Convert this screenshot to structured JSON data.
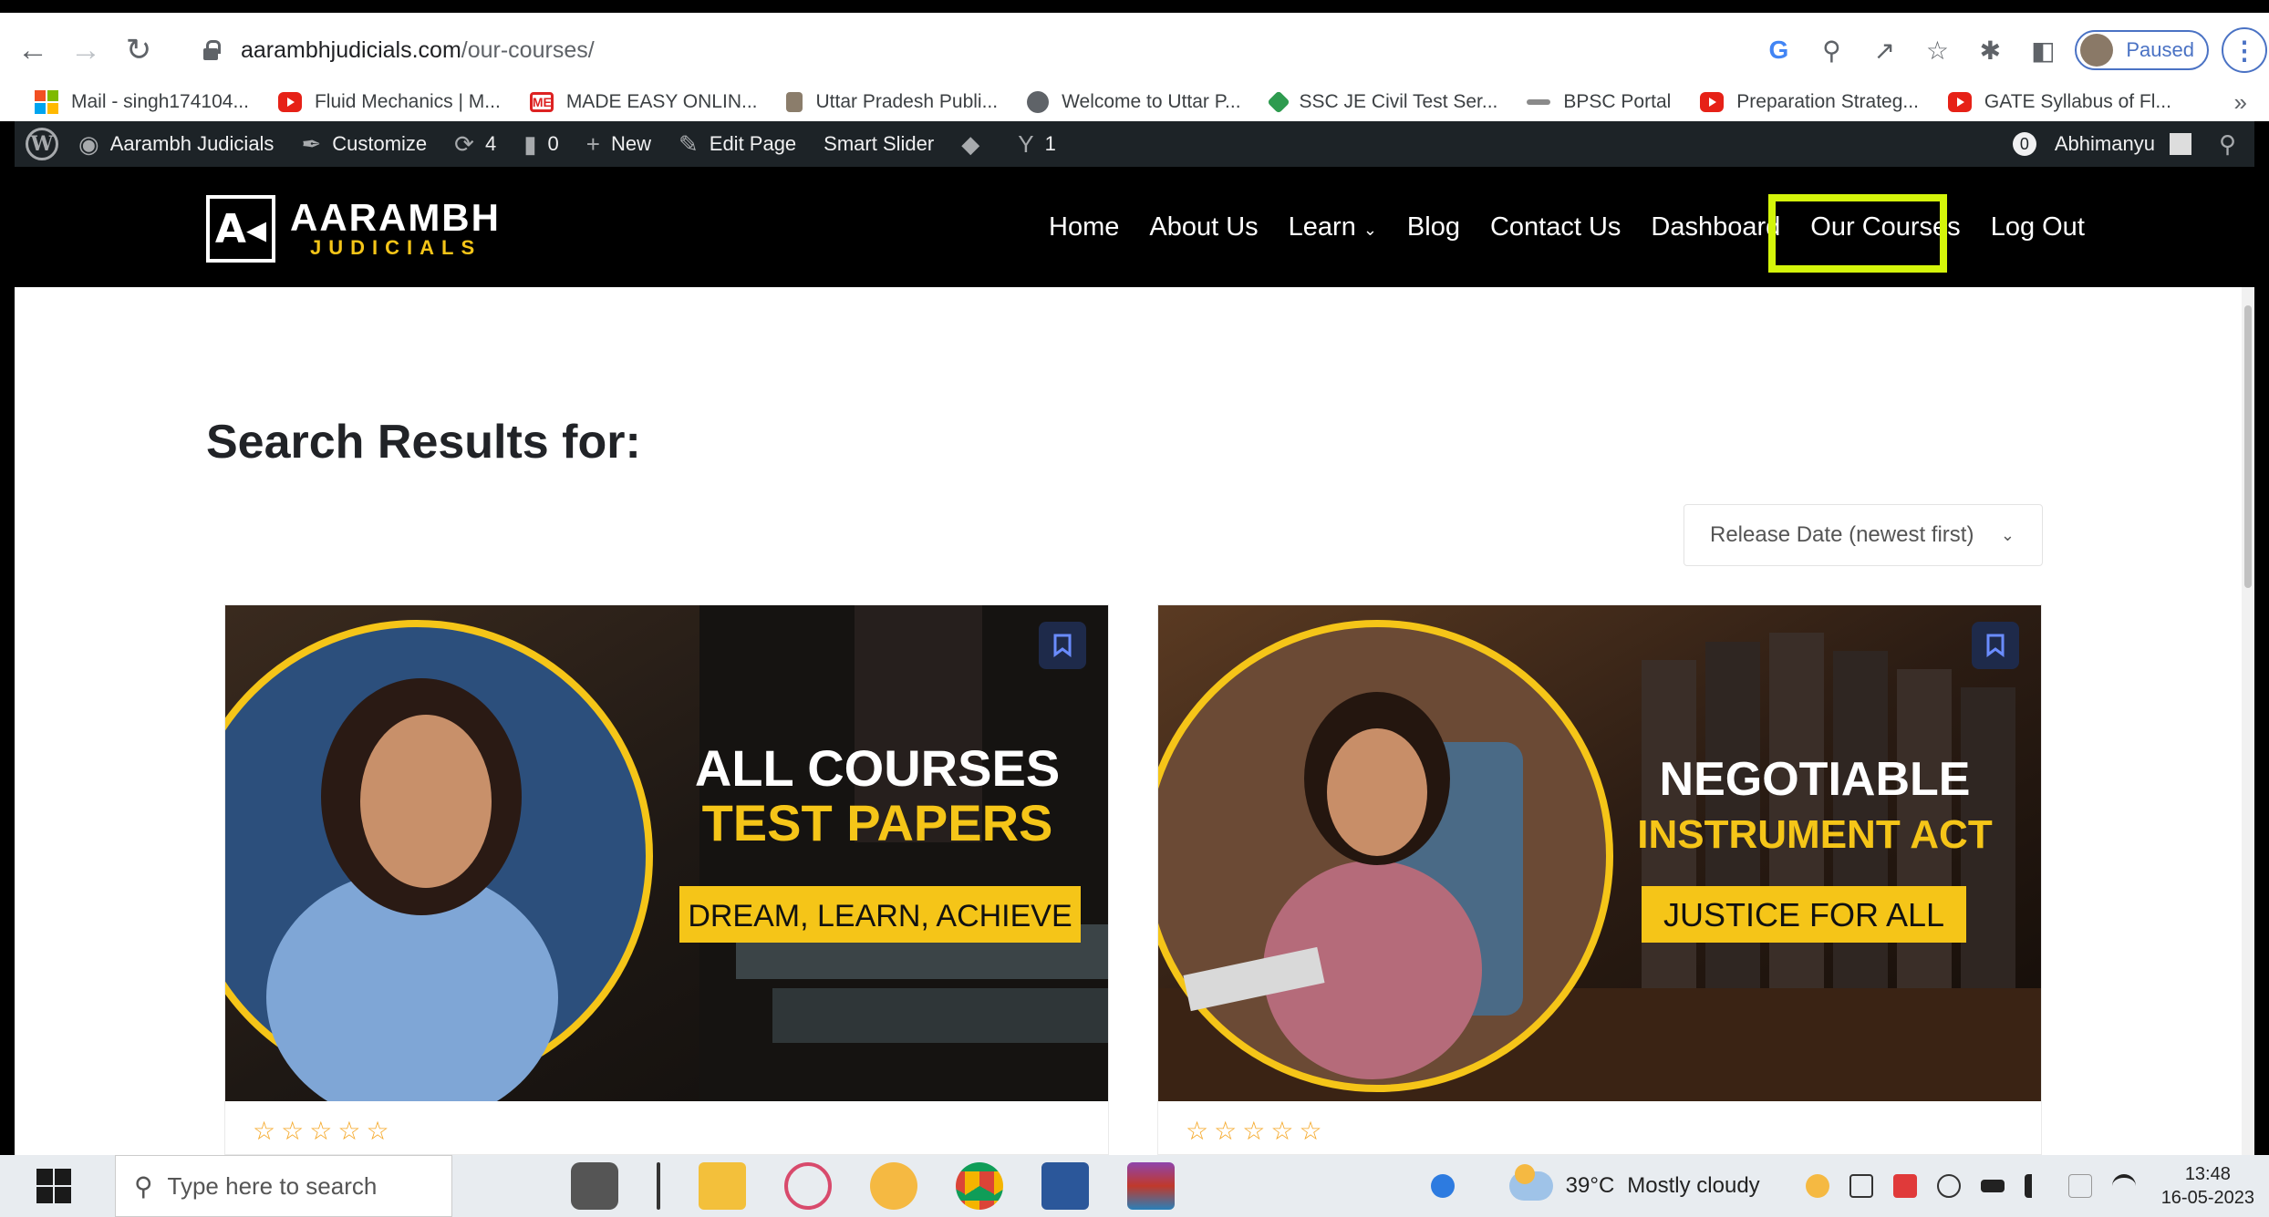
{
  "browser": {
    "url_host": "aarambhjudicials.com",
    "url_path": "/our-courses/",
    "profile_status": "Paused",
    "bookmarks": [
      {
        "label": "Mail - singh174104...",
        "icon": "microsoft-icon"
      },
      {
        "label": "Fluid Mechanics | M...",
        "icon": "youtube-icon"
      },
      {
        "label": "MADE EASY ONLIN...",
        "icon": "madeeasy-icon"
      },
      {
        "label": "Uttar Pradesh Publi...",
        "icon": "emblem-icon"
      },
      {
        "label": "Welcome to Uttar P...",
        "icon": "globe-icon"
      },
      {
        "label": "SSC JE Civil Test Ser...",
        "icon": "testbook-icon"
      },
      {
        "label": "BPSC Portal",
        "icon": "bpsc-icon"
      },
      {
        "label": "Preparation Strateg...",
        "icon": "youtube-icon"
      },
      {
        "label": "GATE Syllabus of Fl...",
        "icon": "youtube-icon"
      }
    ]
  },
  "wp_admin_bar": {
    "site_name": "Aarambh Judicials",
    "customize": "Customize",
    "updates_count": "4",
    "comments_count": "0",
    "new": "New",
    "edit_page": "Edit Page",
    "smart_slider": "Smart Slider",
    "yoast_count": "1",
    "notif_count": "0",
    "user": "Abhimanyu"
  },
  "site": {
    "logo_word": "AARAMBH",
    "logo_sub": "JUDICIALS",
    "nav": [
      "Home",
      "About Us",
      "Learn",
      "Blog",
      "Contact Us",
      "Dashboard",
      "Our Courses",
      "Log Out"
    ],
    "highlight_color": "#d4f50a"
  },
  "page": {
    "title": "Search Results for:",
    "sort_label": "Release Date (newest first)"
  },
  "courses": [
    {
      "line1": "ALL COURSES",
      "line2": "TEST PAPERS",
      "tagline": "DREAM, LEARN, ACHIEVE",
      "stars": 5
    },
    {
      "line1": "NEGOTIABLE",
      "line2": "INSTRUMENT ACT",
      "tagline": "JUSTICE FOR ALL",
      "stars": 5
    }
  ],
  "taskbar": {
    "search_placeholder": "Type here to search",
    "temperature": "39°C",
    "weather": "Mostly cloudy",
    "time": "13:48",
    "date": "16-05-2023"
  }
}
